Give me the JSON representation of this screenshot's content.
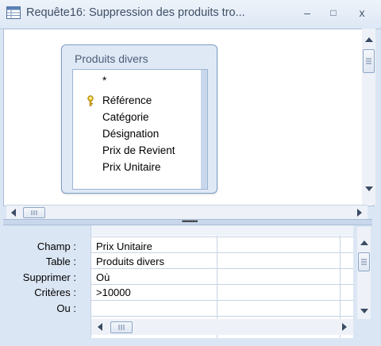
{
  "window": {
    "title": "Requête16: Suppression des produits tro...",
    "minimize_glyph": "–",
    "restore_glyph": "□",
    "close_glyph": "x"
  },
  "table": {
    "name": "Produits divers",
    "fields": [
      "*",
      "Référence",
      "Catégorie",
      "Désignation",
      "Prix de Revient",
      "Prix Unitaire"
    ],
    "primary_key_field": "Référence"
  },
  "grid": {
    "row_labels": {
      "champ": "Champ :",
      "table": "Table :",
      "supprimer": "Supprimer :",
      "criteres": "Critères :",
      "ou": "Ou :"
    },
    "column1": {
      "champ": "Prix Unitaire",
      "table": "Produits divers",
      "supprimer": "Où",
      "criteres": ">10000",
      "ou": ""
    }
  },
  "icons": {
    "key": "key-icon",
    "app": "query-icon"
  },
  "colors": {
    "window_bg": "#dbe6f4",
    "table_border": "#7f9dc4",
    "title_text": "#3f4f66"
  }
}
